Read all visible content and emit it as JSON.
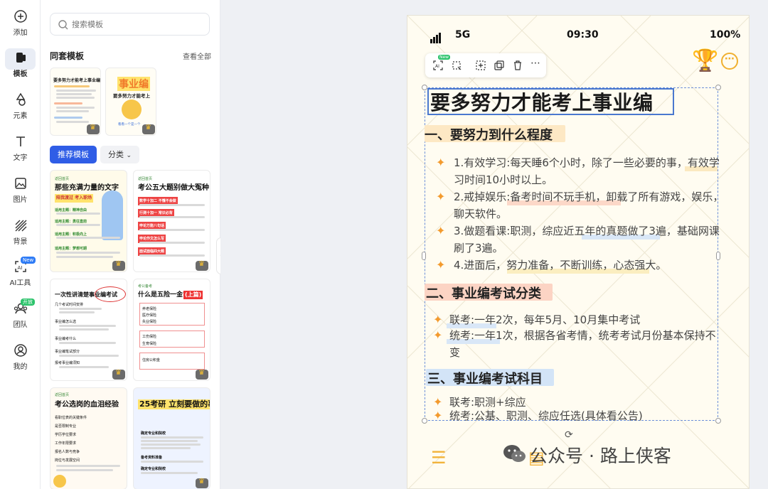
{
  "rail": {
    "items": [
      {
        "label": "添加",
        "icon": "plus-circle-icon"
      },
      {
        "label": "模板",
        "icon": "template-icon",
        "active": true
      },
      {
        "label": "元素",
        "icon": "shapes-icon"
      },
      {
        "label": "文字",
        "icon": "text-icon"
      },
      {
        "label": "图片",
        "icon": "image-icon"
      },
      {
        "label": "背景",
        "icon": "background-icon"
      },
      {
        "label": "AI工具",
        "icon": "ai-tools-icon",
        "badge": "New"
      },
      {
        "label": "团队",
        "icon": "team-icon",
        "badge": "开放"
      },
      {
        "label": "我的",
        "icon": "user-icon"
      }
    ]
  },
  "panel": {
    "search_placeholder": "搜索模板",
    "set_title": "同套模板",
    "see_all": "查看全部",
    "set_templates": [
      {
        "title": "要多努力才能考上事业编",
        "lines": [
          "一、要努力到什么程度",
          "二、事业编考试分类",
          "三、事业编考试科目"
        ]
      },
      {
        "title": "事业编",
        "subtitle": "要多努力才能考上",
        "footer": "看看一个是一个"
      }
    ],
    "recommended_label": "推荐模板",
    "category_label": "分类",
    "cards": [
      {
        "tag": "返回首页",
        "title": "那些充满力量的文字",
        "subtitle": "陪我渡过 考入职场",
        "points": [
          "适用主题：精神自由",
          "适用主题：勇往直前",
          "适用主题：积极向上",
          "适用主题：梦想可期"
        ]
      },
      {
        "tag": "返回首页",
        "title": "考公五大题别做大冤种",
        "points": [
          "数学十加二 不懂不会做",
          "行测十加一 常识必背",
          "申论万能八句话",
          "申论作文怎么写",
          "面试面临四大题"
        ]
      },
      {
        "tag": "",
        "title": "一次性讲清楚事业编考试",
        "points": [
          "几个考试时间安排",
          "事业编怎么选",
          "事业编考什么",
          "事业编笔试部分",
          "报考事业编须知"
        ]
      },
      {
        "tag": "考公备考",
        "title": "什么是五险一金?",
        "highlight": "(上篇)",
        "points": [
          "养老保险",
          "医疗保险",
          "失业保险",
          "工伤保险",
          "生育保险",
          "住房公积金"
        ]
      },
      {
        "tag": "返回首页",
        "title": "考公选岗的血泪经验",
        "points": [
          "看职位表的关键条件",
          "是否限制专业",
          "学历学位要求",
          "工作年限要求",
          "报名人数与竞争",
          "岗位与发展空间"
        ]
      },
      {
        "tag": "",
        "title": "25考研 立刻要做的事!",
        "points": [
          "确定专业和院校",
          "备考资料准备",
          "确定专业和院校"
        ]
      }
    ]
  },
  "canvas": {
    "status": {
      "signal": "5G",
      "time": "09:30",
      "battery": "100%"
    },
    "toolbar": {
      "items": [
        "ai-cutout-icon",
        "crop-icon",
        "ai-enhance-icon",
        "copy-icon",
        "delete-icon",
        "more-icon"
      ],
      "badge": "New"
    },
    "title": "要多努力才能考上事业编",
    "sections": [
      {
        "heading": "一、要努力到什么程度",
        "color": "#fde8c4",
        "items": [
          "1.有效学习:每天睡6个小时，除了一些必要的事，有效学习时间10小时以上。",
          "2.戒掉娱乐:备考时间不玩手机，卸载了所有游戏，娱乐，聊天软件。",
          "3.做题看课:职测，综应近五年的真题做了3遍，基础网课刷了3遍。",
          "4.进面后，努力准备，不断训练，心态强大。"
        ]
      },
      {
        "heading": "二、事业编考试分类",
        "color": "#fcd4c4",
        "items": [
          "联考:一年2次，每年5月、10月集中考试",
          "统考:一年1次，根据各省考情，统考考试月份基本保持不变"
        ]
      },
      {
        "heading": "三、事业编考试科目",
        "color": "#d3e4f7",
        "items": [
          "联考:职测+综应",
          "统考:公基、职测、综应任选(具体看公告)"
        ]
      }
    ],
    "watermark": "公众号 · 路上侠客",
    "background_text": "稿定"
  }
}
